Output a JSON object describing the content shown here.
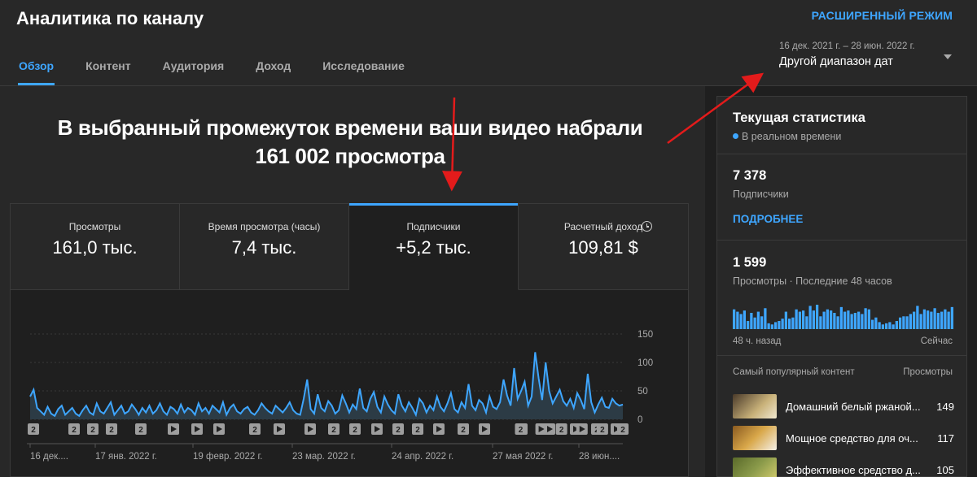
{
  "header": {
    "title": "Аналитика по каналу",
    "advanced_mode": "РАСШИРЕННЫЙ РЕЖИМ"
  },
  "tabs": [
    {
      "label": "Обзор",
      "active": true
    },
    {
      "label": "Контент",
      "active": false
    },
    {
      "label": "Аудитория",
      "active": false
    },
    {
      "label": "Доход",
      "active": false
    },
    {
      "label": "Исследование",
      "active": false
    }
  ],
  "date_picker": {
    "range": "16 дек. 2021 г. – 28 июн. 2022 г.",
    "label": "Другой диапазон дат"
  },
  "headline": {
    "line1": "В выбранный промежуток времени ваши видео набрали",
    "line2": "161 002 просмотра"
  },
  "metrics": [
    {
      "label": "Просмотры",
      "value": "161,0 тыс."
    },
    {
      "label": "Время просмотра (часы)",
      "value": "7,4 тыс."
    },
    {
      "label": "Подписчики",
      "value": "+5,2 тыс."
    },
    {
      "label": "Расчетный доход",
      "value": "109,81 $"
    }
  ],
  "chart_data": {
    "type": "area",
    "ylim": [
      0,
      150
    ],
    "yticks": [
      "150",
      "100",
      "50",
      "0"
    ],
    "xticks": [
      "16 дек....",
      "17 янв. 2022 г.",
      "19 февр. 2022 г.",
      "23 мар. 2022 г.",
      "24 апр. 2022 г.",
      "27 мая 2022 г.",
      "28 июн...."
    ],
    "values": [
      40,
      52,
      20,
      14,
      8,
      22,
      10,
      6,
      18,
      24,
      8,
      14,
      20,
      10,
      6,
      16,
      24,
      12,
      8,
      28,
      14,
      10,
      20,
      30,
      8,
      16,
      24,
      10,
      14,
      26,
      18,
      8,
      20,
      12,
      24,
      10,
      16,
      28,
      14,
      8,
      22,
      18,
      10,
      26,
      12,
      20,
      16,
      8,
      28,
      14,
      20,
      10,
      24,
      18,
      12,
      30,
      8,
      20,
      26,
      14,
      10,
      18,
      22,
      12,
      8,
      16,
      28,
      20,
      14,
      10,
      24,
      18,
      12,
      20,
      30,
      16,
      10,
      8,
      36,
      70,
      18,
      10,
      44,
      20,
      14,
      32,
      24,
      10,
      16,
      42,
      28,
      12,
      26,
      18,
      54,
      20,
      14,
      36,
      48,
      22,
      12,
      40,
      26,
      16,
      10,
      44,
      24,
      14,
      30,
      20,
      8,
      36,
      28,
      12,
      24,
      16,
      40,
      22,
      14,
      28,
      46,
      18,
      12,
      30,
      20,
      62,
      24,
      16,
      34,
      28,
      12,
      40,
      22,
      18,
      30,
      70,
      42,
      24,
      90,
      36,
      50,
      66,
      24,
      40,
      118,
      72,
      34,
      100,
      50,
      28,
      40,
      52,
      32,
      24,
      36,
      20,
      46,
      34,
      18,
      80,
      30,
      12,
      26,
      38,
      22,
      20,
      36,
      28,
      24,
      26
    ],
    "event_markers": [
      "2",
      "2",
      "2",
      "2",
      "2",
      "▶",
      "▶",
      "▶",
      "2",
      "▶",
      "▶",
      "2",
      "2",
      "▶",
      "2",
      "2",
      "▶",
      "2",
      "▶",
      "2",
      "▶",
      "▶",
      "2",
      "▶",
      "2",
      "▶",
      "2",
      "▶",
      "2",
      "2"
    ]
  },
  "sidebar": {
    "title": "Текущая статистика",
    "live_label": "В реальном времени",
    "subscribers_value": "7 378",
    "subscribers_label": "Подписчики",
    "more_link": "ПОДРОБНЕЕ",
    "views_value": "1 599",
    "views_label": "Просмотры · Последние 48 часов",
    "bar_values": [
      34,
      30,
      26,
      32,
      14,
      28,
      20,
      30,
      22,
      36,
      10,
      8,
      12,
      14,
      18,
      30,
      18,
      20,
      34,
      30,
      32,
      22,
      40,
      32,
      42,
      22,
      30,
      34,
      32,
      28,
      22,
      38,
      30,
      32,
      26,
      28,
      30,
      26,
      36,
      34,
      16,
      20,
      12,
      8,
      10,
      12,
      8,
      14,
      20,
      22,
      22,
      26,
      30,
      40,
      26,
      34,
      32,
      30,
      36,
      28,
      30,
      34,
      30,
      38
    ],
    "axis_left": "48 ч. назад",
    "axis_right": "Сейчас",
    "top_content_label": "Самый популярный контент",
    "top_content_views_label": "Просмотры",
    "top_content": [
      {
        "title": "Домашний белый ржаной...",
        "views": "149",
        "thumb_color": "#c9b27a"
      },
      {
        "title": "Мощное средство для оч...",
        "views": "117",
        "thumb_color": "#d9a84a"
      },
      {
        "title": "Эффективное средство д...",
        "views": "105",
        "thumb_color": "#8a9a4a"
      }
    ]
  },
  "colors": {
    "accent": "#3ea6ff",
    "line": "#3ea6ff",
    "annotation_arrow": "#e31b1b"
  }
}
